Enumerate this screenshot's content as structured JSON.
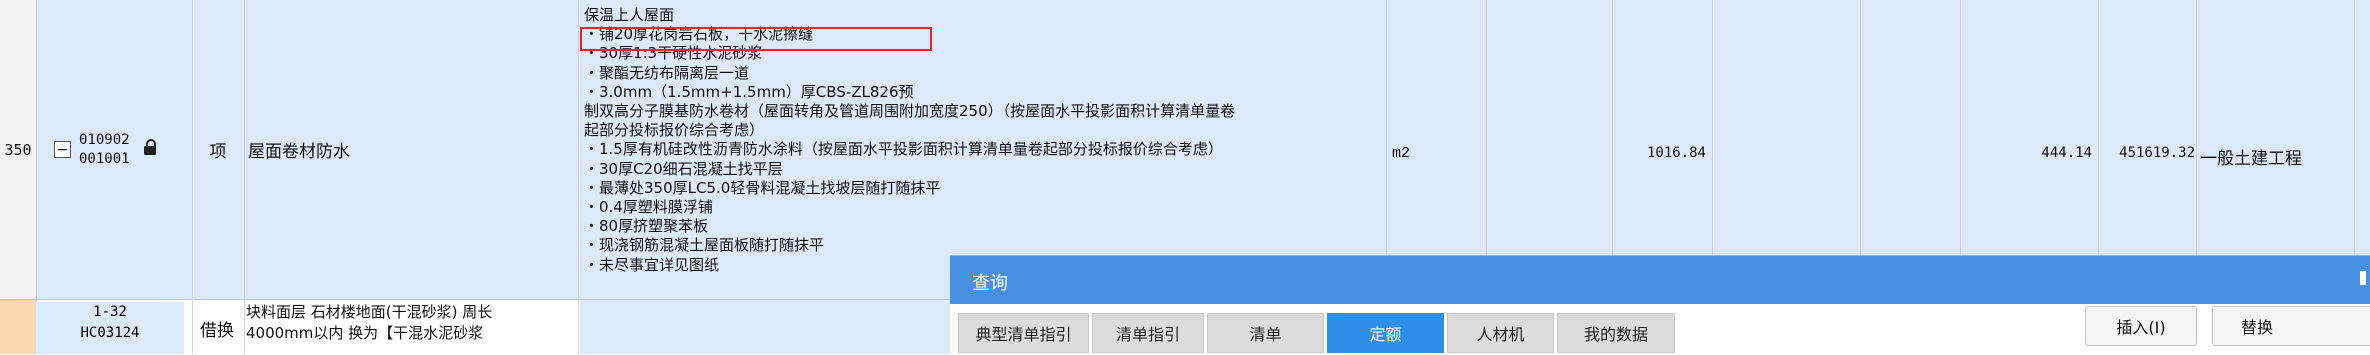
{
  "row": {
    "number": "350",
    "code_line1": "010902",
    "code_line2": "001001",
    "type": "项",
    "name": "屋面卷材防水",
    "description_lines": [
      "保温上人屋面",
      "・铺20厚花岗岩石板，干水泥擦缝",
      "・30厚1:3干硬性水泥砂浆",
      "・聚酯无纺布隔离层一道",
      "・3.0mm（1.5mm+1.5mm）厚CBS-ZL826预",
      "制双高分子膜基防水卷材（屋面转角及管道周围附加宽度250）（按屋面水平投影面积计算清单量卷",
      "起部分投标报价综合考虑）",
      "・1.5厚有机硅改性沥青防水涂料（按屋面水平投影面积计算清单量卷起部分投标报价综合考虑）",
      "・30厚C20细石混凝土找平层",
      "・最薄处350厚LC5.0轻骨料混凝土找坡层随打随抹平",
      "・0.4厚塑料膜浮铺",
      "・80厚挤塑聚苯板",
      "・现浇钢筋混凝土屋面板随打随抹平",
      "・未尽事宜详见图纸"
    ],
    "unit": "m2",
    "quantity": "1016.84",
    "unit_price": "444.14",
    "total_price": "451619.32",
    "profession": "一般土建工程"
  },
  "subrow": {
    "code_line1": "1-32",
    "code_line2": "HC03124",
    "type": "借换",
    "name_lines": [
      "块料面层 石材楼地面(干混砂浆) 周长",
      "4000mm以内  换为【干混水泥砂浆"
    ]
  },
  "query_panel": {
    "title": "查询",
    "tabs": [
      {
        "label": "典型清单指引",
        "active": false
      },
      {
        "label": "清单指引",
        "active": false
      },
      {
        "label": "清单",
        "active": false
      },
      {
        "label": "定额",
        "active": true
      },
      {
        "label": "人材机",
        "active": false
      },
      {
        "label": "我的数据",
        "active": false
      }
    ],
    "insert_button": "插入(I)",
    "replace_button": "替换"
  },
  "colors": {
    "row_highlight": "#dce9f8",
    "panel_header": "#4a90e2",
    "active_tab": "#2f8fe8",
    "callout_border": "#e8252b",
    "subrow_number": "#f8d9b0"
  }
}
